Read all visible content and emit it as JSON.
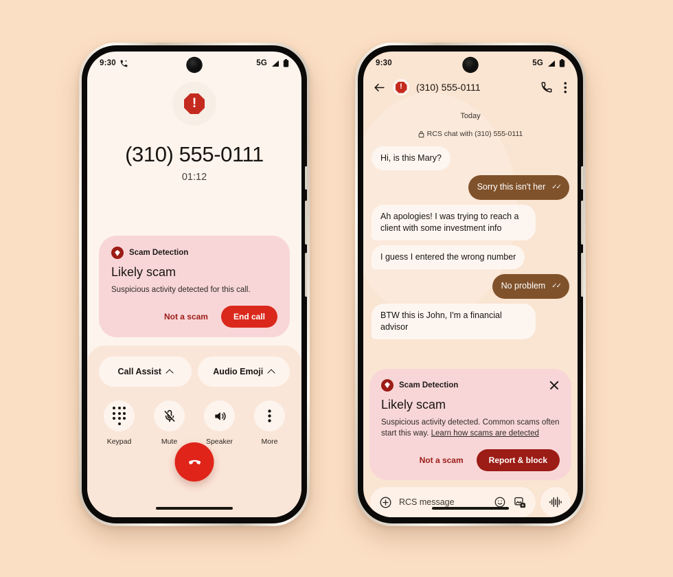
{
  "page": {
    "background_color": "#fbdfc4",
    "accent_red": "#da291c",
    "accent_dark_red": "#9c1c16",
    "scam_card_bg": "#f8d6d8",
    "outgoing_bubble": "#80522b"
  },
  "call_phone": {
    "status_bar": {
      "time": "9:30",
      "call_icon": "phone-ring-icon",
      "network": "5G",
      "signal_icon": "signal-bars-icon",
      "battery_icon": "battery-full-icon"
    },
    "caller_avatar_icon": "scam-octagon-warning-icon",
    "number": "(310) 555-0111",
    "duration": "01:12",
    "scam_card": {
      "icon": "scam-detection-shield-icon",
      "header": "Scam Detection",
      "title": "Likely scam",
      "description": "Suspicious activity detected for this call.",
      "secondary_action": "Not a scam",
      "primary_action": "End call"
    },
    "assist_chips": [
      {
        "label": "Call Assist",
        "icon": "chevron-up-icon"
      },
      {
        "label": "Audio Emoji",
        "icon": "chevron-up-icon"
      }
    ],
    "controls": [
      {
        "label": "Keypad",
        "icon": "keypad-icon"
      },
      {
        "label": "Mute",
        "icon": "mic-off-icon"
      },
      {
        "label": "Speaker",
        "icon": "speaker-icon"
      },
      {
        "label": "More",
        "icon": "more-vertical-icon"
      }
    ],
    "end_call_button": {
      "icon": "end-call-icon",
      "label": "End call"
    }
  },
  "message_phone": {
    "status_bar": {
      "time": "9:30",
      "network": "5G",
      "signal_icon": "signal-bars-icon",
      "battery_icon": "battery-full-icon"
    },
    "header": {
      "back_icon": "back-arrow-icon",
      "avatar_icon": "scam-octagon-warning-icon",
      "title": "(310) 555-0111",
      "call_icon": "phone-icon",
      "menu_icon": "more-vertical-icon"
    },
    "day_divider": "Today",
    "rcs_note": "RCS chat with (310) 555-0111",
    "rcs_note_icon": "lock-icon",
    "messages": [
      {
        "direction": "in",
        "text": "Hi, is this Mary?"
      },
      {
        "direction": "out",
        "text": "Sorry this isn't her",
        "status_icon": "double-check-icon"
      },
      {
        "direction": "in",
        "text": "Ah apologies! I was trying to reach a client with some investment info"
      },
      {
        "direction": "in",
        "text": "I guess I entered the wrong number"
      },
      {
        "direction": "out",
        "text": "No problem",
        "status_icon": "double-check-icon"
      },
      {
        "direction": "in",
        "text": "BTW this is John, I'm a financial advisor"
      }
    ],
    "scam_card": {
      "icon": "scam-detection-shield-icon",
      "header": "Scam Detection",
      "close_icon": "close-icon",
      "title": "Likely scam",
      "description": "Suspicious activity detected. Common scams often start this way. ",
      "link_text": "Learn how scams are detected",
      "secondary_action": "Not a scam",
      "primary_action": "Report & block"
    },
    "composer": {
      "add_icon": "plus-circle-icon",
      "placeholder": "RCS message",
      "emoji_icon": "emoji-smiley-icon",
      "gallery_icon": "image-picker-icon",
      "mic_icon": "voice-waveform-icon"
    }
  }
}
